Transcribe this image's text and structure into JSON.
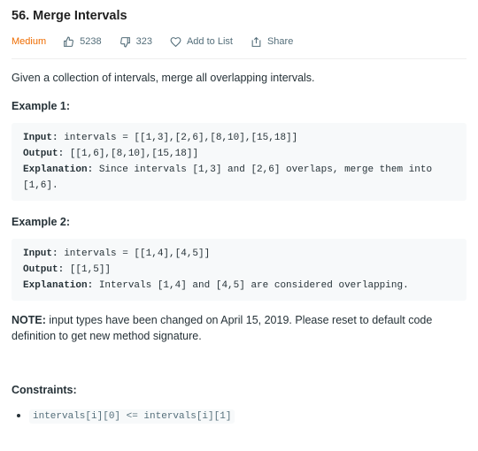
{
  "problem": {
    "title": "56. Merge Intervals",
    "difficulty": "Medium",
    "likes": "5238",
    "dislikes": "323",
    "add_to_list_label": "Add to List",
    "share_label": "Share"
  },
  "description": "Given a collection of intervals, merge all overlapping intervals.",
  "examples": [
    {
      "title": "Example 1:",
      "input_label": "Input:",
      "input": " intervals = [[1,3],[2,6],[8,10],[15,18]]",
      "output_label": "Output:",
      "output": " [[1,6],[8,10],[15,18]]",
      "explanation_label": "Explanation:",
      "explanation": " Since intervals [1,3] and [2,6] overlaps, merge them into [1,6]."
    },
    {
      "title": "Example 2:",
      "input_label": "Input:",
      "input": " intervals = [[1,4],[4,5]]",
      "output_label": "Output:",
      "output": " [[1,5]]",
      "explanation_label": "Explanation:",
      "explanation": " Intervals [1,4] and [4,5] are considered overlapping."
    }
  ],
  "note": {
    "label": "NOTE:",
    "text": " input types have been changed on April 15, 2019. Please reset to default code definition to get new method signature."
  },
  "constraints": {
    "title": "Constraints:",
    "items": [
      "intervals[i][0] <= intervals[i][1]"
    ]
  },
  "colors": {
    "difficulty": "#ef6c00",
    "meta": "#546e7a",
    "code_bg": "#f7f9fa"
  }
}
